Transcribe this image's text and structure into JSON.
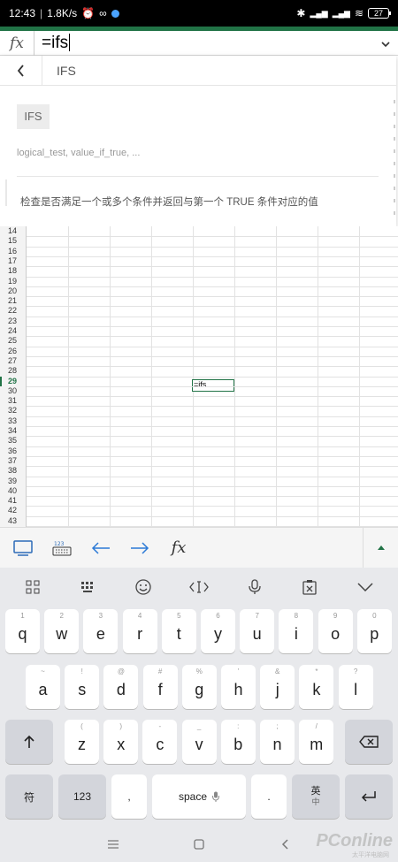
{
  "status_bar": {
    "time": "12:43",
    "net_speed": "1.8K/s",
    "battery": "27"
  },
  "formula_bar": {
    "value": "=ifs"
  },
  "function_help": {
    "title": "IFS",
    "chip": "IFS",
    "syntax": "logical_test, value_if_true, ...",
    "description": "检查是否满足一个或多个条件并返回与第一个 TRUE 条件对应的值"
  },
  "grid": {
    "row_numbers": [
      "14",
      "15",
      "16",
      "17",
      "18",
      "19",
      "20",
      "21",
      "22",
      "23",
      "24",
      "25",
      "26",
      "27",
      "28",
      "29",
      "30",
      "31",
      "32",
      "33",
      "34",
      "35",
      "36",
      "37",
      "38",
      "39",
      "40",
      "41",
      "42",
      "43"
    ],
    "active_row": "29",
    "active_cell_value": "=ifs"
  },
  "keyboard": {
    "row1": [
      {
        "hint": "1",
        "key": "q"
      },
      {
        "hint": "2",
        "key": "w"
      },
      {
        "hint": "3",
        "key": "e"
      },
      {
        "hint": "4",
        "key": "r"
      },
      {
        "hint": "5",
        "key": "t"
      },
      {
        "hint": "6",
        "key": "y"
      },
      {
        "hint": "7",
        "key": "u"
      },
      {
        "hint": "8",
        "key": "i"
      },
      {
        "hint": "9",
        "key": "o"
      },
      {
        "hint": "0",
        "key": "p"
      }
    ],
    "row2": [
      {
        "hint": "~",
        "key": "a"
      },
      {
        "hint": "!",
        "key": "s"
      },
      {
        "hint": "@",
        "key": "d"
      },
      {
        "hint": "#",
        "key": "f"
      },
      {
        "hint": "%",
        "key": "g"
      },
      {
        "hint": "'",
        "key": "h"
      },
      {
        "hint": "&",
        "key": "j"
      },
      {
        "hint": "*",
        "key": "k"
      },
      {
        "hint": "?",
        "key": "l"
      }
    ],
    "row3": [
      {
        "hint": "(",
        "key": "z"
      },
      {
        "hint": ")",
        "key": "x"
      },
      {
        "hint": "-",
        "key": "c"
      },
      {
        "hint": "_",
        "key": "v"
      },
      {
        "hint": ":",
        "key": "b"
      },
      {
        "hint": ";",
        "key": "n"
      },
      {
        "hint": "/",
        "key": "m"
      }
    ],
    "symbols_label": "符",
    "numbers_label": "123",
    "comma_label": ",",
    "space_label": "space",
    "period_label": ".",
    "lang_label": "英",
    "lang_sub": "中"
  },
  "watermark": {
    "brand": "PConline",
    "sub": "太平洋电脑网"
  }
}
